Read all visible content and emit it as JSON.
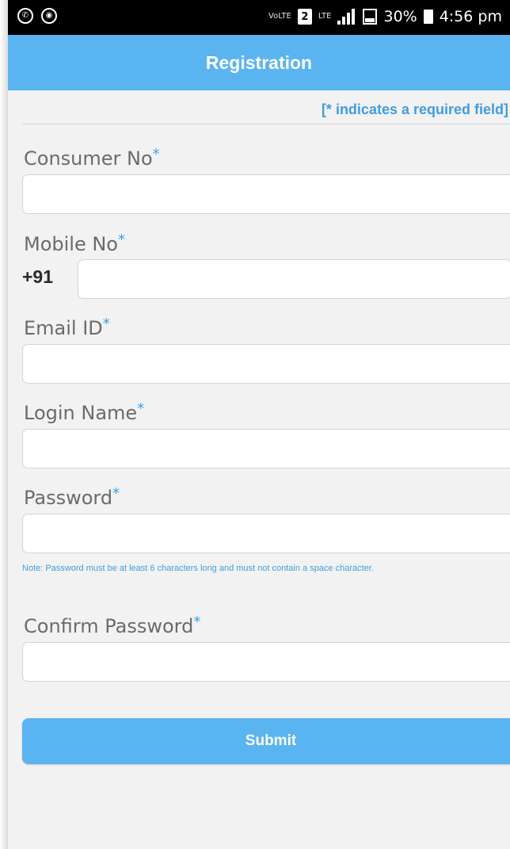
{
  "status_bar": {
    "left_icons": [
      "whatsapp-icon",
      "location-icon"
    ],
    "volte_label": "VoLTE",
    "sim_badge": "2",
    "network": "LTE",
    "battery": "30%",
    "time": "4:56 pm"
  },
  "header": {
    "title": "Registration"
  },
  "form": {
    "required_note": "[* indicates a required field]",
    "required_mark": "*",
    "consumer_no": {
      "label": "Consumer No",
      "value": ""
    },
    "mobile_no": {
      "label": "Mobile No",
      "prefix": "+91",
      "value": ""
    },
    "email": {
      "label": "Email ID",
      "value": ""
    },
    "login_name": {
      "label": "Login Name",
      "value": ""
    },
    "password": {
      "label": "Password",
      "value": "",
      "note": "Note: Password must be at least 6 characters long and must not contain a space character."
    },
    "confirm_password": {
      "label": "Confirm Password",
      "value": ""
    },
    "submit_label": "Submit"
  },
  "colors": {
    "accent": "#5ab4ef",
    "link": "#3f9de0",
    "background": "#f2f2f2",
    "label": "#6b6b6b"
  }
}
